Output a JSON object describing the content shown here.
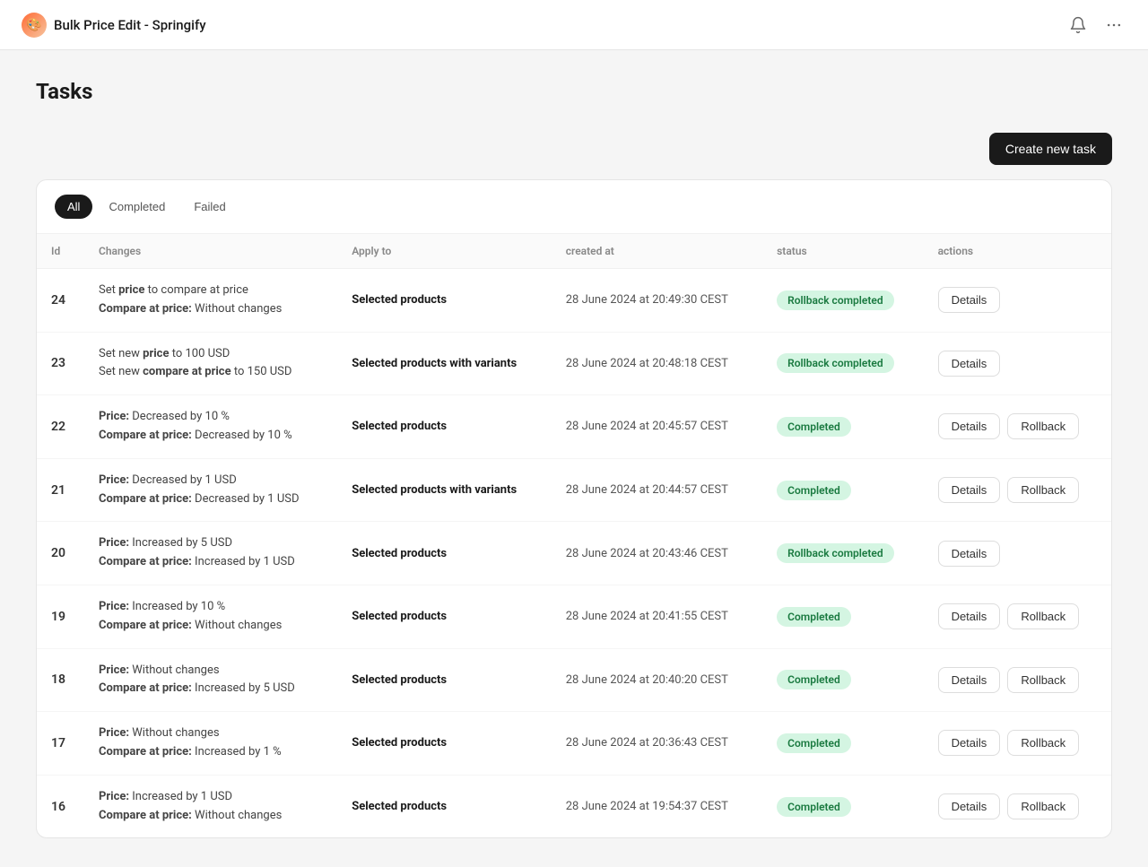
{
  "header": {
    "title": "Bulk Price Edit - Springify",
    "logo": "🎨"
  },
  "page": {
    "title": "Tasks"
  },
  "toolbar": {
    "create_label": "Create new task"
  },
  "filters": {
    "tabs": [
      {
        "id": "all",
        "label": "All",
        "active": true
      },
      {
        "id": "completed",
        "label": "Completed",
        "active": false
      },
      {
        "id": "failed",
        "label": "Failed",
        "active": false
      }
    ]
  },
  "table": {
    "columns": [
      "Id",
      "Changes",
      "Apply to",
      "created at",
      "status",
      "actions"
    ],
    "rows": [
      {
        "id": "24",
        "changes": [
          "Set <strong>price</strong> to compare at price",
          "<strong>Compare at price:</strong> Without changes"
        ],
        "changes_raw": [
          {
            "prefix": "Set ",
            "bold": "price",
            "suffix": " to compare at price"
          },
          {
            "prefix": "",
            "bold": "Compare at price:",
            "suffix": " Without changes"
          }
        ],
        "apply_to": "Selected products",
        "created_at": "28 June 2024 at 20:49:30 CEST",
        "status": "Rollback completed",
        "status_type": "rollback-completed",
        "actions": [
          "Details"
        ]
      },
      {
        "id": "23",
        "changes": [
          "Set new <strong>price</strong> to 100 USD",
          "Set new <strong>compare at price</strong> to 150 USD"
        ],
        "changes_raw": [
          {
            "prefix": "Set new ",
            "bold": "price",
            "suffix": " to 100 USD"
          },
          {
            "prefix": "Set new ",
            "bold": "compare at price",
            "suffix": " to 150 USD"
          }
        ],
        "apply_to": "Selected products with variants",
        "created_at": "28 June 2024 at 20:48:18 CEST",
        "status": "Rollback completed",
        "status_type": "rollback-completed",
        "actions": [
          "Details"
        ]
      },
      {
        "id": "22",
        "changes": [
          "<strong>Price:</strong> Decreased by 10 %",
          "<strong>Compare at price:</strong> Decreased by 10 %"
        ],
        "changes_raw": [
          {
            "prefix": "",
            "bold": "Price:",
            "suffix": " Decreased by 10 %"
          },
          {
            "prefix": "",
            "bold": "Compare at price:",
            "suffix": " Decreased by 10 %"
          }
        ],
        "apply_to": "Selected products",
        "created_at": "28 June 2024 at 20:45:57 CEST",
        "status": "Completed",
        "status_type": "completed",
        "actions": [
          "Details",
          "Rollback"
        ]
      },
      {
        "id": "21",
        "changes": [
          "<strong>Price:</strong> Decreased by 1 USD",
          "<strong>Compare at price:</strong> Decreased by 1 USD"
        ],
        "changes_raw": [
          {
            "prefix": "",
            "bold": "Price:",
            "suffix": " Decreased by 1 USD"
          },
          {
            "prefix": "",
            "bold": "Compare at price:",
            "suffix": " Decreased by 1 USD"
          }
        ],
        "apply_to": "Selected products with variants",
        "created_at": "28 June 2024 at 20:44:57 CEST",
        "status": "Completed",
        "status_type": "completed",
        "actions": [
          "Details",
          "Rollback"
        ]
      },
      {
        "id": "20",
        "changes": [
          "<strong>Price:</strong> Increased by 5 USD",
          "<strong>Compare at price:</strong> Increased by 1 USD"
        ],
        "changes_raw": [
          {
            "prefix": "",
            "bold": "Price:",
            "suffix": " Increased by 5 USD"
          },
          {
            "prefix": "",
            "bold": "Compare at price:",
            "suffix": " Increased by 1 USD"
          }
        ],
        "apply_to": "Selected products",
        "created_at": "28 June 2024 at 20:43:46 CEST",
        "status": "Rollback completed",
        "status_type": "rollback-completed",
        "actions": [
          "Details"
        ]
      },
      {
        "id": "19",
        "changes": [
          "<strong>Price:</strong> Increased by 10 %",
          "<strong>Compare at price:</strong> Without changes"
        ],
        "changes_raw": [
          {
            "prefix": "",
            "bold": "Price:",
            "suffix": " Increased by 10 %"
          },
          {
            "prefix": "",
            "bold": "Compare at price:",
            "suffix": " Without changes"
          }
        ],
        "apply_to": "Selected products",
        "created_at": "28 June 2024 at 20:41:55 CEST",
        "status": "Completed",
        "status_type": "completed",
        "actions": [
          "Details",
          "Rollback"
        ]
      },
      {
        "id": "18",
        "changes": [
          "<strong>Price:</strong> Without changes",
          "<strong>Compare at price:</strong> Increased by 5 USD"
        ],
        "changes_raw": [
          {
            "prefix": "",
            "bold": "Price:",
            "suffix": " Without changes"
          },
          {
            "prefix": "",
            "bold": "Compare at price:",
            "suffix": " Increased by 5 USD"
          }
        ],
        "apply_to": "Selected products",
        "created_at": "28 June 2024 at 20:40:20 CEST",
        "status": "Completed",
        "status_type": "completed",
        "actions": [
          "Details",
          "Rollback"
        ]
      },
      {
        "id": "17",
        "changes": [
          "<strong>Price:</strong> Without changes",
          "<strong>Compare at price:</strong> Increased by 1 %"
        ],
        "changes_raw": [
          {
            "prefix": "",
            "bold": "Price:",
            "suffix": " Without changes"
          },
          {
            "prefix": "",
            "bold": "Compare at price:",
            "suffix": " Increased by 1 %"
          }
        ],
        "apply_to": "Selected products",
        "created_at": "28 June 2024 at 20:36:43 CEST",
        "status": "Completed",
        "status_type": "completed",
        "actions": [
          "Details",
          "Rollback"
        ]
      },
      {
        "id": "16",
        "changes": [
          "<strong>Price:</strong> Increased by 1 USD",
          "<strong>Compare at price:</strong> Without changes"
        ],
        "changes_raw": [
          {
            "prefix": "",
            "bold": "Price:",
            "suffix": " Increased by 1 USD"
          },
          {
            "prefix": "",
            "bold": "Compare at price:",
            "suffix": " Without changes"
          }
        ],
        "apply_to": "Selected products",
        "created_at": "28 June 2024 at 19:54:37 CEST",
        "status": "Completed",
        "status_type": "completed",
        "actions": [
          "Details",
          "Rollback"
        ]
      }
    ]
  }
}
